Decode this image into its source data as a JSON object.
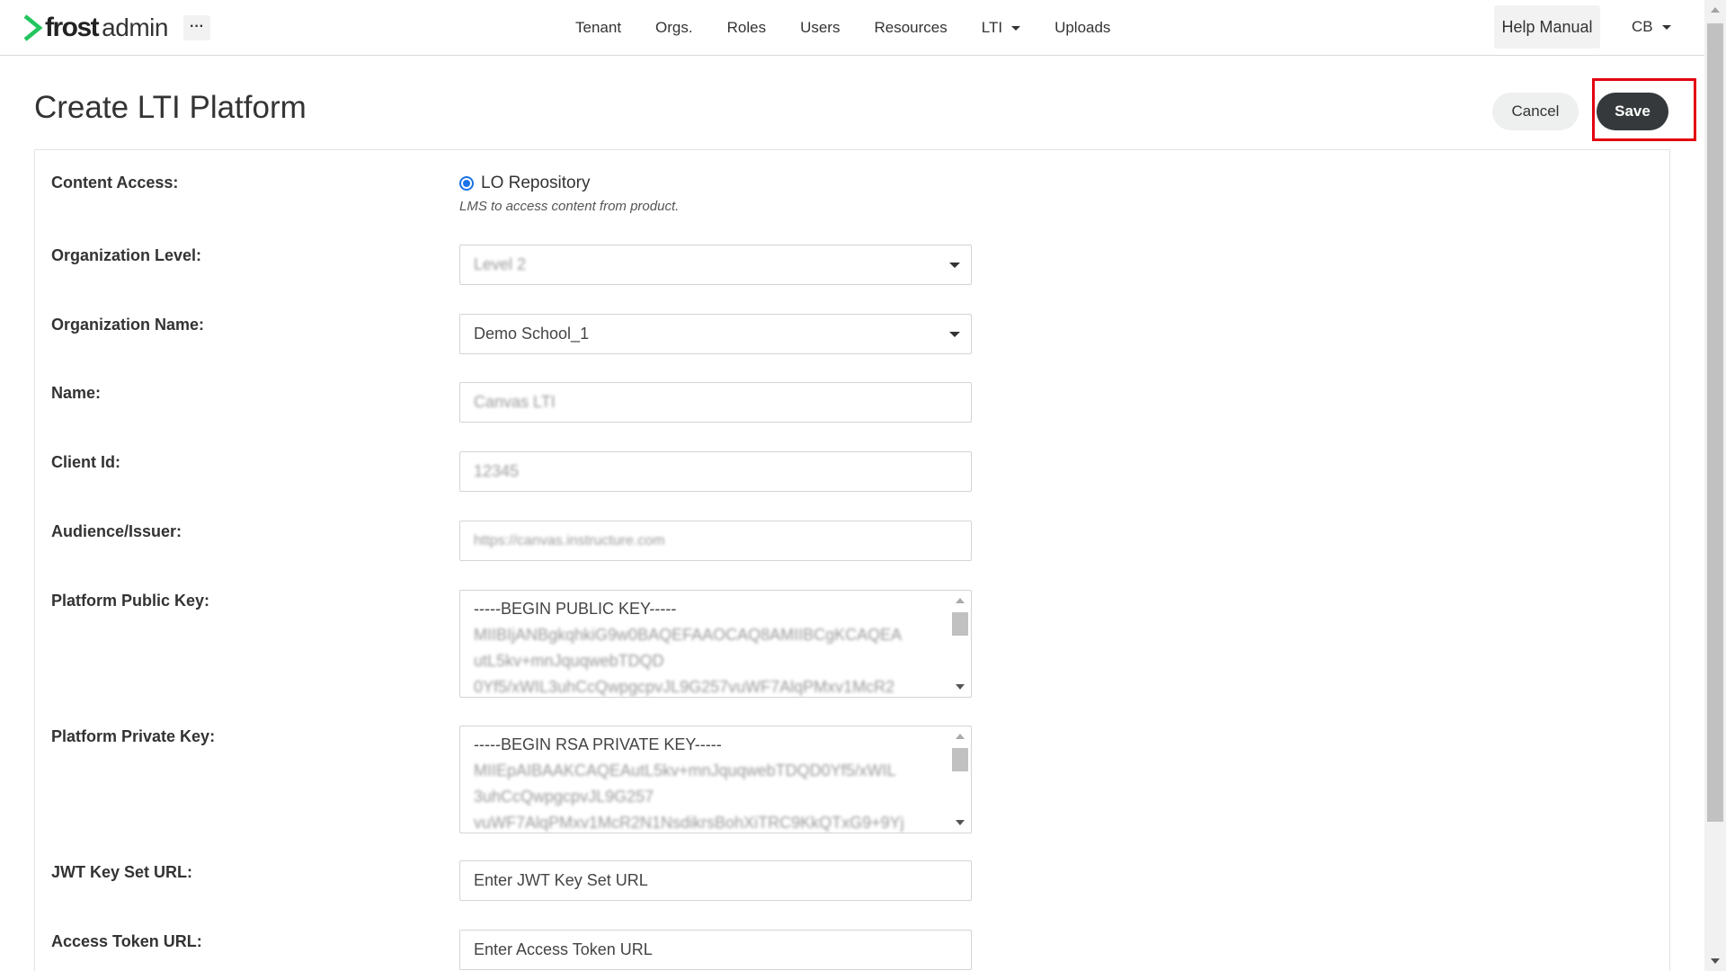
{
  "app": {
    "logo_brand": "frost",
    "logo_suffix": "admin",
    "more_label": "···",
    "accent_color": "#22c55e"
  },
  "nav": {
    "items": [
      {
        "label": "Tenant"
      },
      {
        "label": "Orgs."
      },
      {
        "label": "Roles"
      },
      {
        "label": "Users"
      },
      {
        "label": "Resources"
      },
      {
        "label": "LTI",
        "has_dropdown": true
      },
      {
        "label": "Uploads"
      }
    ],
    "help_label": "Help Manual",
    "user_initials": "CB"
  },
  "header": {
    "title": "Create LTI Platform",
    "cancel_label": "Cancel",
    "save_label": "Save",
    "highlight_color": "#e3000f"
  },
  "form": {
    "content_access": {
      "label": "Content Access:",
      "option": "LO Repository",
      "selected": true,
      "help": "LMS to access content from product."
    },
    "org_level": {
      "label": "Organization Level:",
      "value": "Level 2"
    },
    "org_name": {
      "label": "Organization Name:",
      "value": "Demo School_1"
    },
    "name": {
      "label": "Name:",
      "value": "Canvas LTI"
    },
    "client_id": {
      "label": "Client Id:",
      "value": "12345"
    },
    "audience": {
      "label": "Audience/Issuer:",
      "value": "https://canvas.instructure.com"
    },
    "public_key": {
      "label": "Platform Public Key:",
      "lines": [
        "-----BEGIN PUBLIC KEY-----",
        "MIIBIjANBgkqhkiG9w0BAQEFAAOCAQ8AMIIBCgKCAQEA",
        "utL5kv+mnJquqwebTDQD",
        "0Yf5/xWIL3uhCcQwpgcpvJL9G257vuWF7AlqPMxv1McR2"
      ]
    },
    "private_key": {
      "label": "Platform Private Key:",
      "lines": [
        "-----BEGIN RSA PRIVATE KEY-----",
        "MIIEpAIBAAKCAQEAutL5kv+mnJquqwebTDQD0Yf5/xWIL",
        "3uhCcQwpgcpvJL9G257",
        "vuWF7AlqPMxv1McR2N1NsdikrsBohXiTRC9KkQTxG9+9Yj"
      ]
    },
    "jwt_url": {
      "label": "JWT Key Set URL:",
      "placeholder": "Enter JWT Key Set URL"
    },
    "token_url": {
      "label": "Access Token URL:",
      "placeholder": "Enter Access Token URL"
    }
  }
}
